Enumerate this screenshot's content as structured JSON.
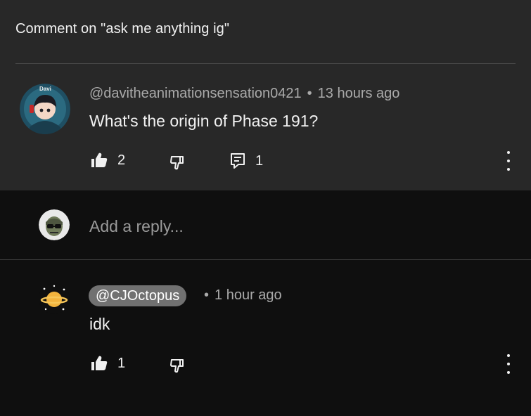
{
  "header": {
    "title": "Comment on \"ask me anything ig\""
  },
  "comment": {
    "avatar_label": "Davi",
    "author": "@davitheanimationsensation0421",
    "separator": "•",
    "time": "13 hours ago",
    "text": "What's the origin of Phase 191?",
    "likes": "2",
    "replies": "1"
  },
  "reply_box": {
    "placeholder": "Add a reply..."
  },
  "reply": {
    "author": "@CJOctopus",
    "separator": "•",
    "time": "1 hour ago",
    "text": "idk",
    "likes": "1"
  },
  "icons": {
    "like": "thumbs-up-icon",
    "dislike": "thumbs-down-icon",
    "reply": "comment-icon",
    "more": "more-vertical-icon"
  },
  "colors": {
    "comment_bg": "#282828",
    "page_bg": "#0f0f0f",
    "meta_text": "#aaaaaa",
    "chip_bg": "#717171"
  }
}
